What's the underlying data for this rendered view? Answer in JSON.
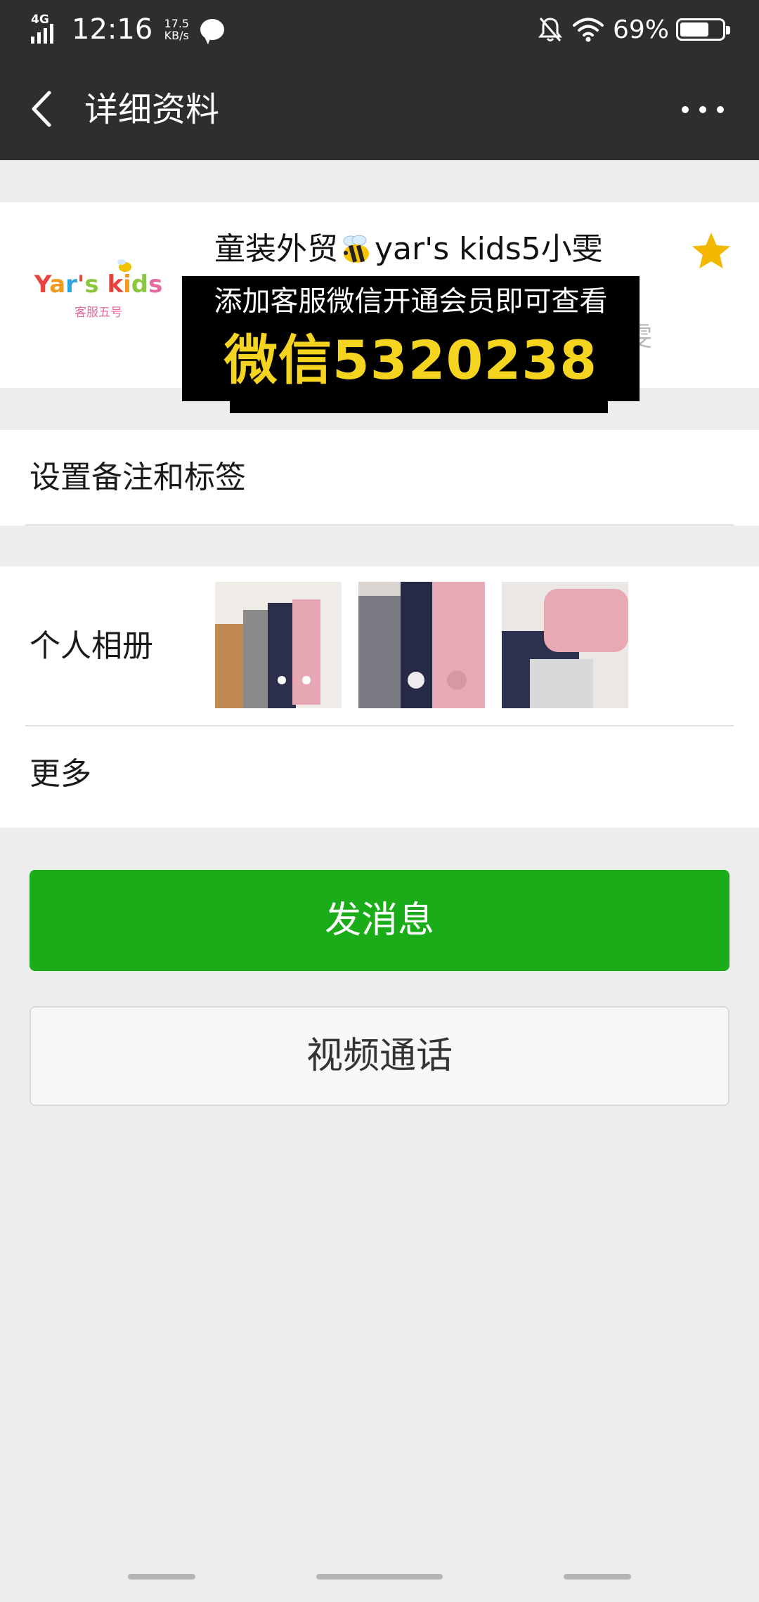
{
  "status_bar": {
    "network": "4G",
    "time": "12:16",
    "speed_value": "17.5",
    "speed_unit": "KB/s",
    "battery": "69%",
    "battery_level": 0.69
  },
  "nav": {
    "title": "详细资料"
  },
  "profile": {
    "name_prefix": "童装外贸",
    "name_suffix": "yar's kids5小雯",
    "avatar_brand_line1": "Yar's kids",
    "avatar_brand_line2": "客服五号",
    "obscured_text": "雯",
    "overlay_line1": "添加客服微信开通会员即可查看",
    "overlay_line2": "微信5320238",
    "starred": true
  },
  "rows": {
    "remark_tags": "设置备注和标签",
    "album": "个人相册",
    "more": "更多"
  },
  "buttons": {
    "send_message": "发消息",
    "video_call": "视频通话"
  },
  "colors": {
    "header_bg": "#2e2e2e",
    "primary_green": "#1aad19",
    "star_yellow": "#f5b800",
    "overlay_yellow": "#f5d41f"
  },
  "icons": [
    "back-arrow-icon",
    "more-dots-icon",
    "star-icon",
    "bee-icon",
    "chat-bubble-icon",
    "mute-bell-icon",
    "wifi-icon",
    "battery-icon"
  ]
}
